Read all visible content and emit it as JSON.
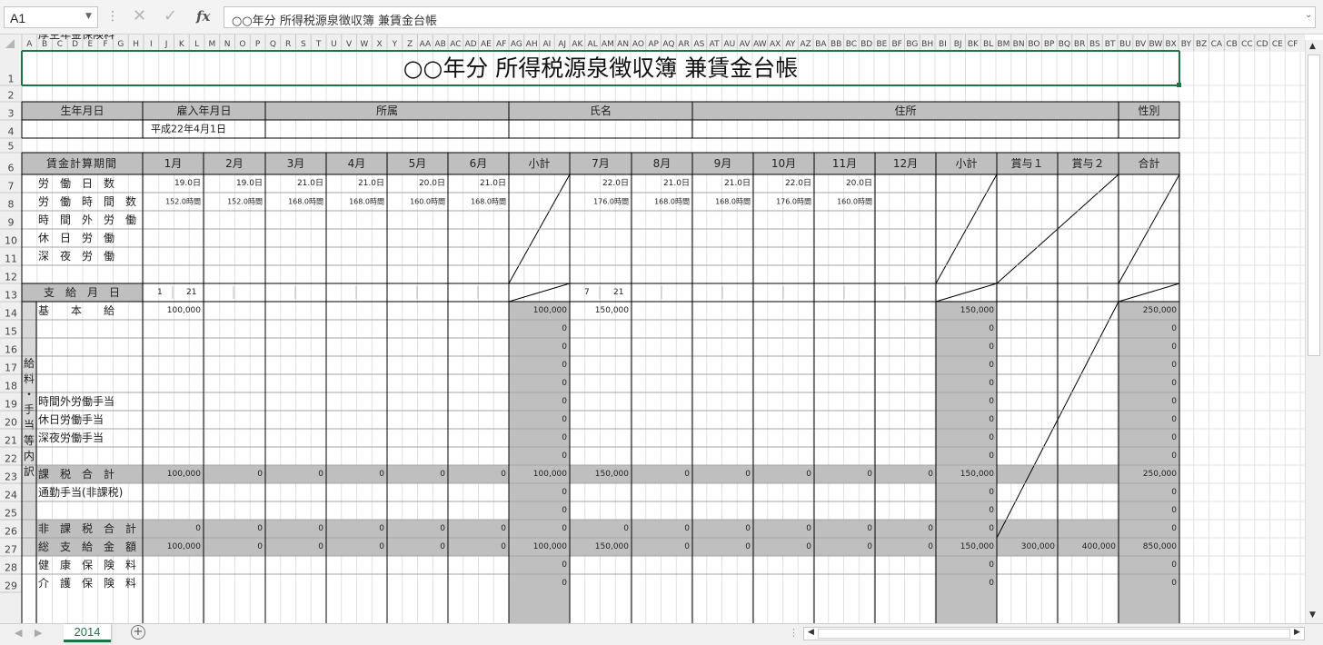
{
  "formula_bar": {
    "name_box": "A1",
    "formula": "○○年分 所得税源泉徴収簿 兼賃金台帳",
    "cancel_icon": "cancel-icon",
    "enter_icon": "enter-icon",
    "fx_label": "fx"
  },
  "columns": [
    "A",
    "B",
    "C",
    "D",
    "E",
    "F",
    "G",
    "H",
    "I",
    "J",
    "K",
    "L",
    "M",
    "N",
    "O",
    "P",
    "Q",
    "R",
    "S",
    "T",
    "U",
    "V",
    "W",
    "X",
    "Y",
    "Z",
    "AA",
    "AB",
    "AC",
    "AD",
    "AE",
    "AF",
    "AG",
    "AH",
    "AI",
    "AJ",
    "AK",
    "AL",
    "AM",
    "AN",
    "AO",
    "AP",
    "AQ",
    "AR",
    "AS",
    "AT",
    "AU",
    "AV",
    "AW",
    "AX",
    "AY",
    "AZ",
    "BA",
    "BB",
    "BC",
    "BD",
    "BE",
    "BF",
    "BG",
    "BH",
    "BI",
    "BJ",
    "BK",
    "BL",
    "BM",
    "BN",
    "BO",
    "BP",
    "BQ",
    "BR",
    "BS",
    "BT",
    "BU",
    "BV",
    "BW",
    "BX",
    "BY",
    "BZ",
    "CA",
    "CB",
    "CC",
    "CD",
    "CE",
    "CF"
  ],
  "rows": [
    "1",
    "2",
    "3",
    "4",
    "5",
    "6",
    "7",
    "8",
    "9",
    "10",
    "11",
    "12",
    "13",
    "14",
    "15",
    "16",
    "17",
    "18",
    "19",
    "20",
    "21",
    "22",
    "23",
    "24",
    "25",
    "26",
    "27",
    "28",
    "29"
  ],
  "sheet": {
    "title": "○○年分 所得税源泉徴収簿 兼賃金台帳",
    "header_labels": [
      "生年月日",
      "雇入年月日",
      "所属",
      "氏名",
      "住所",
      "性別"
    ],
    "hire_date": "平成22年4月1日",
    "period_label": "賃金計算期間",
    "months": [
      "1月",
      "2月",
      "3月",
      "4月",
      "5月",
      "6月",
      "小計",
      "7月",
      "8月",
      "9月",
      "10月",
      "11月",
      "12月",
      "小計",
      "賞与１",
      "賞与２",
      "合計"
    ],
    "labor_labels": [
      "労　働　日　数",
      "労　働　時　間　数",
      "時　間　外　労　働",
      "休　日　労　働",
      "深　夜　労　働"
    ],
    "work_days": [
      "19.0日",
      "19.0日",
      "21.0日",
      "21.0日",
      "20.0日",
      "21.0日",
      "",
      "22.0日",
      "21.0日",
      "21.0日",
      "22.0日",
      "20.0日",
      ""
    ],
    "work_hours": [
      "152.0時間",
      "152.0時間",
      "168.0時間",
      "168.0時間",
      "160.0時間",
      "168.0時間",
      "",
      "176.0時間",
      "168.0時間",
      "168.0時間",
      "176.0時間",
      "160.0時間",
      ""
    ],
    "payday_label": "支　給　月　日",
    "payday_h1": [
      "1",
      "21"
    ],
    "payday_h2": [
      "7",
      "21"
    ],
    "side_label": "給料・手当等内訳",
    "pay_labels": [
      "基　　本　　給",
      "",
      "",
      "",
      "",
      "時間外労働手当",
      "休日労働手当",
      "深夜労働手当",
      "",
      "課　税　合　計",
      "通勤手当(非課税)",
      "",
      "非　課　税　合　計",
      "総　支　給　金　額",
      "健　康　保　険　料",
      "介　護　保　険　料",
      "厚生年金保険料"
    ],
    "row14": [
      "100,000",
      "",
      "",
      "",
      "",
      "",
      "100,000",
      "150,000",
      "",
      "",
      "",
      "",
      "",
      "150,000",
      "",
      "",
      "250,000"
    ],
    "zero_rows": [
      "0",
      "0",
      "0",
      "0",
      "0",
      "0",
      "0",
      "0"
    ],
    "row23": [
      "100,000",
      "0",
      "0",
      "0",
      "0",
      "0",
      "100,000",
      "150,000",
      "0",
      "0",
      "0",
      "0",
      "0",
      "150,000",
      "",
      "",
      "250,000"
    ],
    "row26": [
      "0",
      "0",
      "0",
      "0",
      "0",
      "0",
      "0",
      "0",
      "0",
      "0",
      "0",
      "0",
      "0",
      "0",
      "",
      "",
      "0"
    ],
    "row27": [
      "100,000",
      "0",
      "0",
      "0",
      "0",
      "0",
      "100,000",
      "150,000",
      "0",
      "0",
      "0",
      "0",
      "0",
      "150,000",
      "300,000",
      "400,000",
      "850,000"
    ]
  },
  "sheet_tabs": [
    "2014"
  ],
  "add_sheet_icon": "plus-circle-icon"
}
